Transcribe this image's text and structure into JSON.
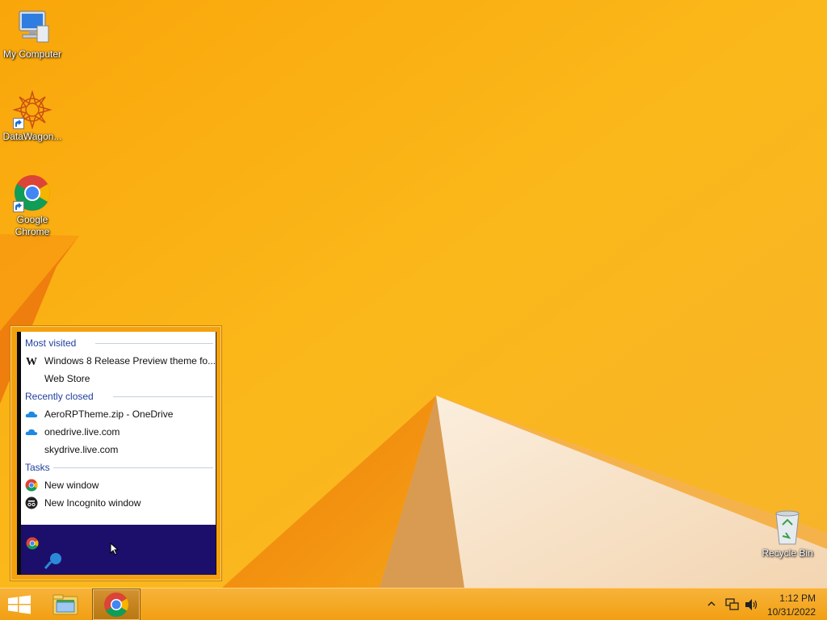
{
  "desktop": {
    "icons": [
      {
        "label": "My Computer",
        "icon": "computer-icon"
      },
      {
        "label": "DataWagon...",
        "icon": "datawagon-icon"
      },
      {
        "label": "Google\nChrome",
        "icon": "chrome-icon"
      }
    ],
    "recycle_bin": {
      "label": "Recycle Bin",
      "icon": "recycle-bin-icon"
    }
  },
  "jumplist": {
    "sections": {
      "most_visited": "Most visited",
      "recently_closed": "Recently closed",
      "tasks": "Tasks"
    },
    "most_visited": [
      {
        "label": "Windows 8 Release Preview theme fo...",
        "icon": "wikipedia-icon"
      },
      {
        "label": "Web Store",
        "icon": ""
      }
    ],
    "recently_closed": [
      {
        "label": "AeroRPTheme.zip - OneDrive",
        "icon": "onedrive-icon"
      },
      {
        "label": "onedrive.live.com",
        "icon": "onedrive-icon"
      },
      {
        "label": "skydrive.live.com",
        "icon": ""
      }
    ],
    "tasks": [
      {
        "label": "New window",
        "icon": "chrome-icon"
      },
      {
        "label": "New Incognito window",
        "icon": "incognito-icon"
      }
    ]
  },
  "taskbar": {
    "start_icon": "windows-logo-icon",
    "pinned": [
      "file-explorer-icon",
      "chrome-icon"
    ],
    "clock": {
      "time": "1:12 PM",
      "date": "10/31/2022"
    },
    "tray_icons": [
      "show-hidden-icons-icon",
      "network-icon",
      "volume-icon"
    ]
  },
  "colors": {
    "wallpaper": "#f8ac0c",
    "section_header": "#1f3f9f",
    "jumplist_footer": "#1b0f6b"
  }
}
